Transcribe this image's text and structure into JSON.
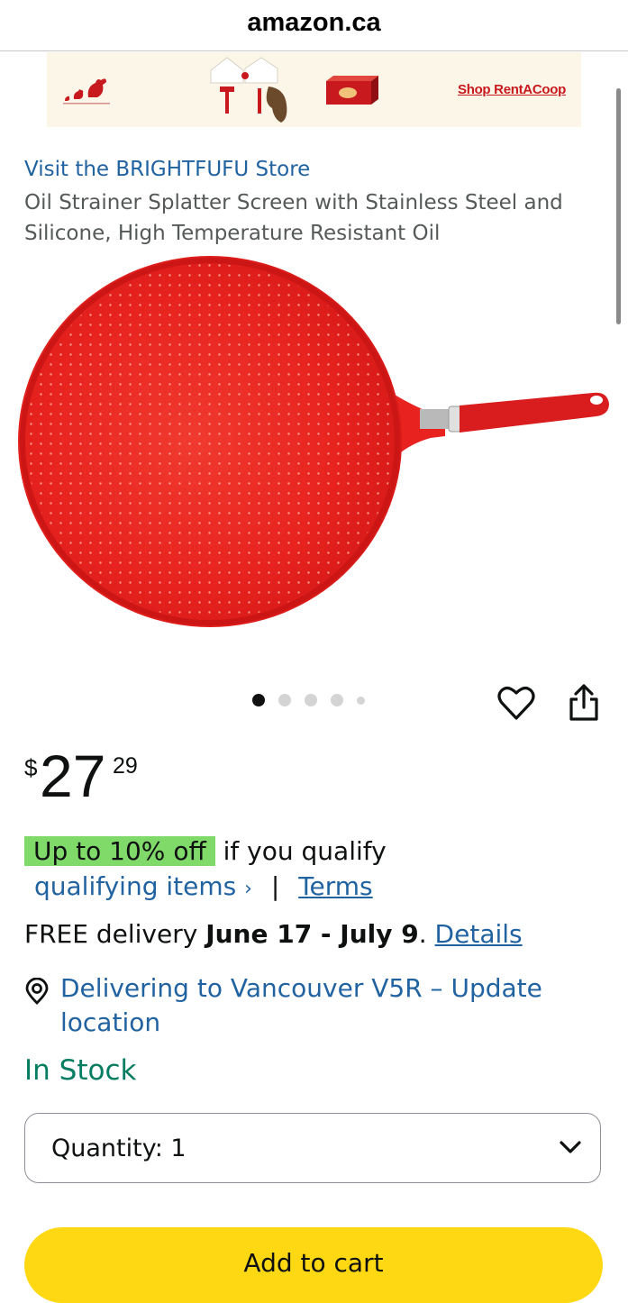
{
  "browser": {
    "url": "amazon.ca"
  },
  "ad": {
    "link_text": "Shop RentACoop"
  },
  "product": {
    "store_link": "Visit the BRIGHTFUFU Store",
    "title": "Oil Strainer Splatter Screen with Stainless Steel and Silicone, High Temperature Resistant Oil",
    "image_count": 5,
    "active_image": 1
  },
  "price": {
    "symbol": "$",
    "whole": "27",
    "fraction": "29"
  },
  "promo": {
    "badge": "Up to 10% off",
    "text": "if you qualify",
    "qualifying_link": "qualifying items",
    "chevron": "›",
    "separator": "|",
    "terms_link": "Terms"
  },
  "delivery": {
    "prefix": "FREE delivery ",
    "dates": "June 17 - July 9",
    "suffix": ". ",
    "details_link": "Details"
  },
  "location": {
    "text": "Delivering to Vancouver V5R – Update location"
  },
  "stock": {
    "status": "In Stock"
  },
  "quantity": {
    "label": "Quantity:",
    "value": "1"
  },
  "cart": {
    "button_label": "Add to cart"
  },
  "icons": {
    "heart": "heart-icon",
    "share": "share-icon",
    "location": "location-pin-icon",
    "dropdown": "chevron-down-icon"
  },
  "colors": {
    "link": "#2162a1",
    "stock": "#067d62",
    "promo_badge": "#7fda69",
    "cart_button": "#ffd814",
    "product_red": "#e8231f"
  }
}
